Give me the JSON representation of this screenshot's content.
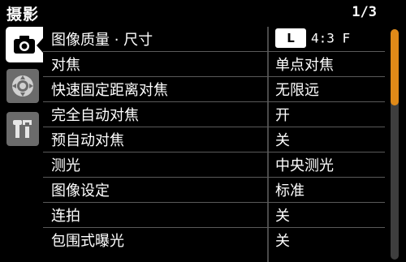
{
  "header": {
    "title": "摄影",
    "page_indicator": "1/3"
  },
  "tabs": [
    {
      "name": "camera-icon",
      "active": true
    },
    {
      "name": "dial-icon",
      "active": false
    },
    {
      "name": "tools-icon",
      "active": false
    }
  ],
  "menu": {
    "items": [
      {
        "label": "图像质量 · 尺寸",
        "value_badge": "L",
        "value": "4:3 F"
      },
      {
        "label": "对焦",
        "value": "单点对焦"
      },
      {
        "label": "快速固定距离对焦",
        "value": "无限远"
      },
      {
        "label": "完全自动对焦",
        "value": "开"
      },
      {
        "label": "预自动对焦",
        "value": "关"
      },
      {
        "label": "测光",
        "value": "中央测光"
      },
      {
        "label": "图像设定",
        "value": "标准"
      },
      {
        "label": "连拍",
        "value": "关"
      },
      {
        "label": "包围式曝光",
        "value": "关"
      }
    ]
  },
  "scrollbar": {
    "position_fraction": 0.0,
    "visible_fraction": 0.33
  },
  "colors": {
    "accent": "#e08a18",
    "background": "#000000",
    "tab_inactive": "#6b6b6b"
  }
}
